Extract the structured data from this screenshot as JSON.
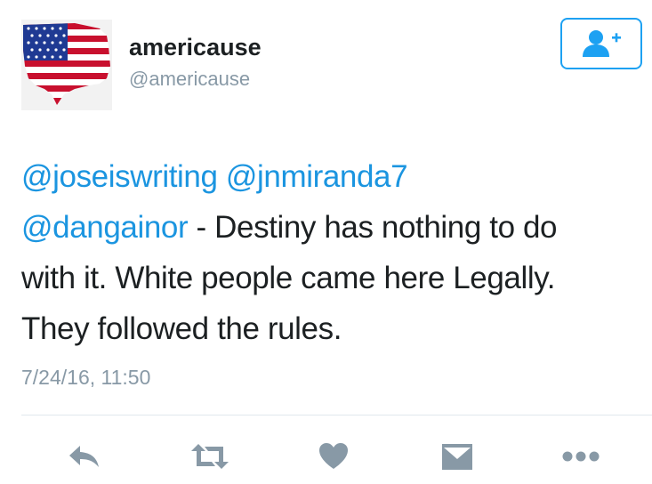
{
  "user": {
    "display_name": "americause",
    "handle": "@americause"
  },
  "follow_button": {
    "icon": "add-user-icon"
  },
  "tweet": {
    "mention_1": "@joseiswriting",
    "mention_2": "@jnmiranda7",
    "mention_3": "@dangainor",
    "text_line_2": " - Destiny has nothing to do",
    "text_line_3": "with it. White people came here Legally.",
    "text_line_4": "They followed the rules.",
    "timestamp": "7/24/16, 11:50"
  },
  "actions": [
    "reply-icon",
    "retweet-icon",
    "like-icon",
    "direct-message-icon",
    "more-icon"
  ],
  "colors": {
    "accent": "#1da1f2",
    "link": "#1b95e0",
    "icon_gray": "#8899a6"
  }
}
